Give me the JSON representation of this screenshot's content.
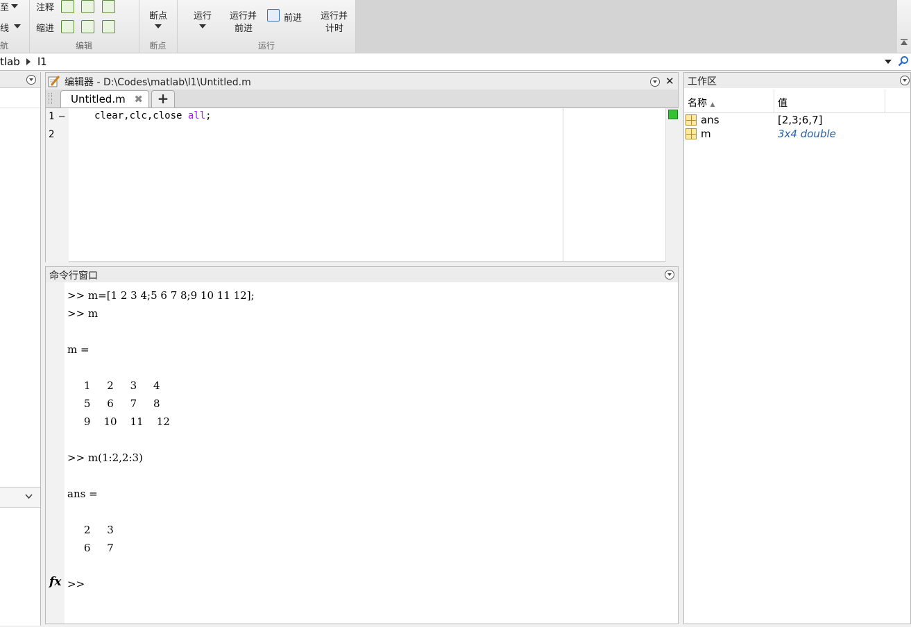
{
  "toolstrip": {
    "left_partial_1": "至",
    "left_partial_2": "线",
    "nav_group_partial": "航",
    "comment_label": "注释",
    "indent_label": "缩进",
    "edit_group_label": "编辑",
    "breakpoint_label": "断点",
    "breakpoint_group_label": "断点",
    "run_label": "运行",
    "run_advance_label_1": "运行并",
    "run_advance_label_2": "前进",
    "advance_label": "前进",
    "run_time_label_1": "运行并",
    "run_time_label_2": "计时",
    "run_group_label": "运行"
  },
  "address": {
    "crumb1": "tlab",
    "crumb2": "l1"
  },
  "editor": {
    "title": "编辑器 - D:\\Codes\\matlab\\l1\\Untitled.m",
    "tab_label": "Untitled.m",
    "line_numbers": [
      "1",
      "2"
    ],
    "line1_dash": "—",
    "code_line1_prefix": "clear,clc,close ",
    "code_line1_keyword": "all",
    "code_line1_suffix": ";"
  },
  "command_window": {
    "title": "命令行窗口",
    "lines": [
      ">> m=[1 2 3 4;5 6 7 8;9 10 11 12];",
      ">> m",
      "",
      "m =",
      "",
      "     1     2     3     4",
      "     5     6     7     8",
      "     9    10    11    12",
      "",
      ">> m(1:2,2:3)",
      "",
      "ans =",
      "",
      "     2     3",
      "     6     7",
      ""
    ],
    "prompt": ">>",
    "fx_label": "fx"
  },
  "workspace": {
    "title": "工作区",
    "col_name": "名称",
    "col_value": "值",
    "variables": [
      {
        "name": "ans",
        "value": "[2,3;6,7]"
      },
      {
        "name": "m",
        "value": "3x4 double"
      }
    ]
  },
  "colors": {
    "keyword": "#a020f0",
    "workspace_italic": "#2660a3",
    "green_marker": "#34c234"
  }
}
